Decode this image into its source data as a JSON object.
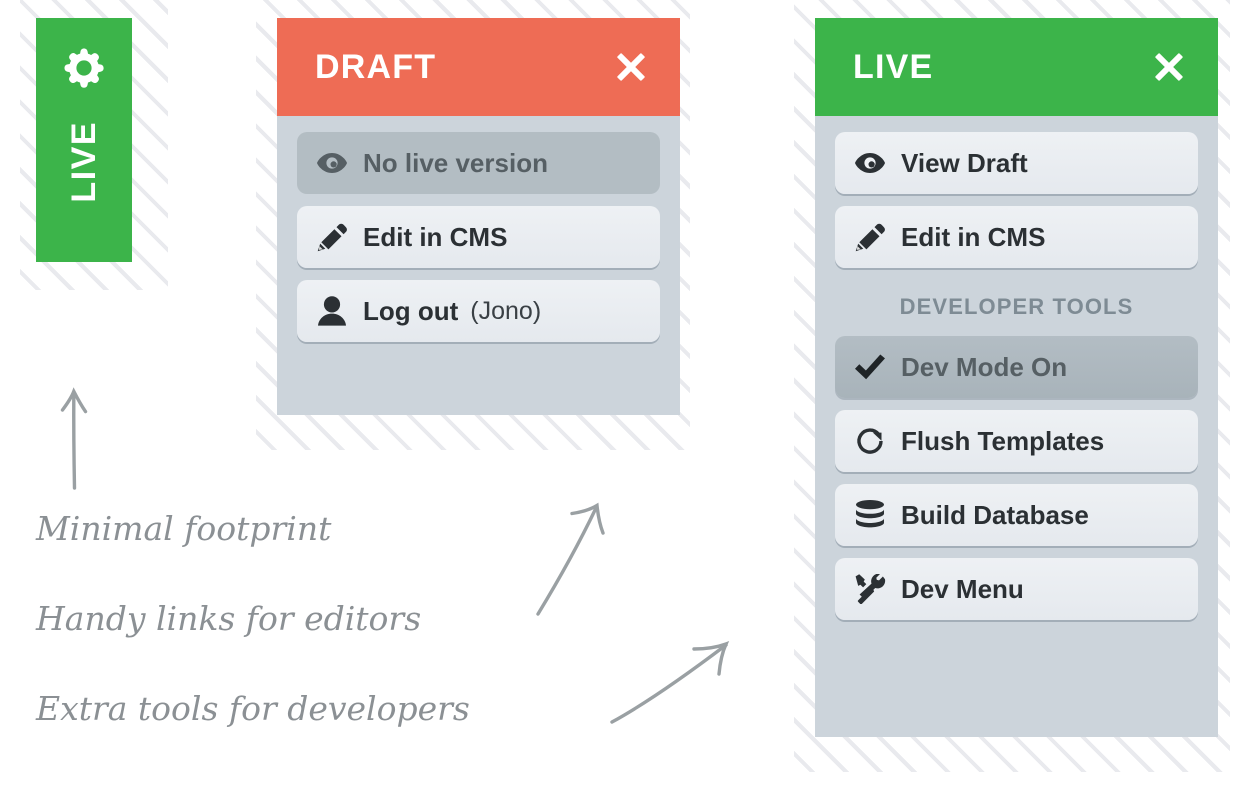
{
  "colors": {
    "draft_header": "#EE6C55",
    "live_header": "#3CB44A",
    "panel_body": "#CCD4DB",
    "item_bg": "#E9EDF1",
    "item_disabled_bg": "#B3BDC3",
    "item_active_bg": "#AEB8BF",
    "text_dark": "#2B3034",
    "text_muted": "#565F64",
    "section_label": "#7E8B94",
    "annotation": "#8B9094",
    "hatch_stripe": "#E9EAEE"
  },
  "collapsed_tab": {
    "name": "collapsed-admin-tab",
    "status_label": "LIVE",
    "icon": "gear-icon"
  },
  "draft_panel": {
    "header": {
      "title": "DRAFT",
      "close_icon": "close-icon"
    },
    "items": [
      {
        "icon": "eye-icon",
        "label": "No live version",
        "sub": "",
        "state": "disabled"
      },
      {
        "icon": "pencil-icon",
        "label": "Edit in CMS",
        "sub": "",
        "state": "normal"
      },
      {
        "icon": "person-icon",
        "label": "Log out",
        "sub": "(Jono)",
        "state": "normal"
      }
    ]
  },
  "live_panel": {
    "header": {
      "title": "LIVE",
      "close_icon": "close-icon"
    },
    "items": [
      {
        "icon": "eye-icon",
        "label": "View Draft",
        "sub": "",
        "state": "normal"
      },
      {
        "icon": "pencil-icon",
        "label": "Edit in CMS",
        "sub": "",
        "state": "normal"
      }
    ],
    "section_label": "DEVELOPER TOOLS",
    "dev_items": [
      {
        "icon": "check-icon",
        "label": "Dev Mode On",
        "sub": "",
        "state": "active"
      },
      {
        "icon": "refresh-icon",
        "label": "Flush Templates",
        "sub": "",
        "state": "normal"
      },
      {
        "icon": "database-icon",
        "label": "Build Database",
        "sub": "",
        "state": "normal"
      },
      {
        "icon": "tools-icon",
        "label": "Dev Menu",
        "sub": "",
        "state": "normal"
      }
    ]
  },
  "annotations": [
    {
      "text": "Minimal footprint",
      "arrow": "arrow-up-to-tab"
    },
    {
      "text": "Handy links for editors",
      "arrow": "arrow-upright-to-draft-panel"
    },
    {
      "text": "Extra tools for developers",
      "arrow": "arrow-upright-to-live-panel"
    }
  ]
}
